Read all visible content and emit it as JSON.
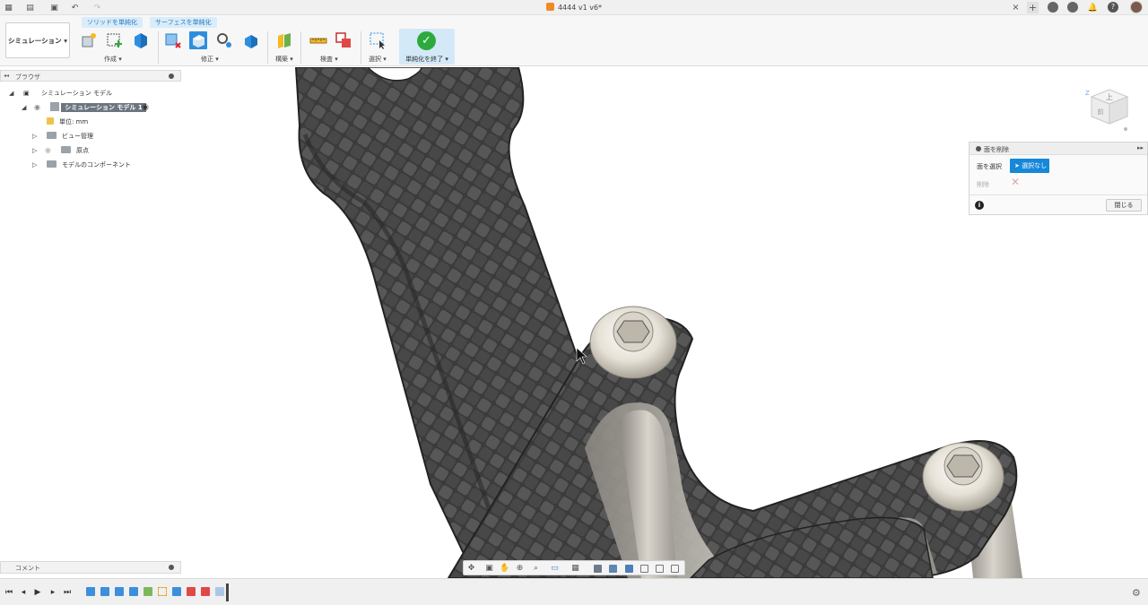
{
  "window": {
    "title": "4444 v1 v6*",
    "icons": [
      "apps-grid-icon",
      "file-icon",
      "save-icon",
      "undo-icon",
      "redo-icon",
      "close-tab-icon",
      "new-tab-icon",
      "extensions-icon",
      "job-status-icon",
      "notifications-icon",
      "help-icon",
      "avatar"
    ]
  },
  "toolbar": {
    "workspace_label": "シミュレーション ▾",
    "tabs": [
      "ソリッドを単純化",
      "サーフェスを単純化"
    ],
    "groups": {
      "create": "作成 ▾",
      "modify": "修正 ▾",
      "construct": "構築 ▾",
      "inspect": "検査 ▾",
      "select": "選択 ▾",
      "finish": "単純化を終了 ▾"
    },
    "accent": "#1687d9",
    "finish_color": "#2eaa3d"
  },
  "browser": {
    "title": "ブラウザ",
    "root": "シミュレーション モデル",
    "model": "シミュレーション モデル 1",
    "units": "単位: mm",
    "children": [
      "ビュー管理",
      "原点",
      "モデルのコンポーネント"
    ]
  },
  "comments": {
    "title": "コメント"
  },
  "dialog": {
    "title": "面を削除",
    "select_label": "面を選択",
    "select_value": "選択なし",
    "delete_label": "削除",
    "close_label": "閉じる"
  },
  "viewcube": {
    "face": "上",
    "side": "前"
  },
  "navbar": {
    "icons": [
      "orbit-icon",
      "look-at-icon",
      "pan-icon",
      "zoom-icon",
      "fit-icon",
      "display-settings-icon",
      "grid-icon",
      "view-cube-1",
      "view-cube-2",
      "view-cube-3",
      "view-cube-4",
      "view-cube-5",
      "view-cube-6"
    ]
  },
  "timeline": {
    "controls": [
      "skip-start",
      "step-back",
      "play",
      "step-forward",
      "skip-end"
    ]
  }
}
